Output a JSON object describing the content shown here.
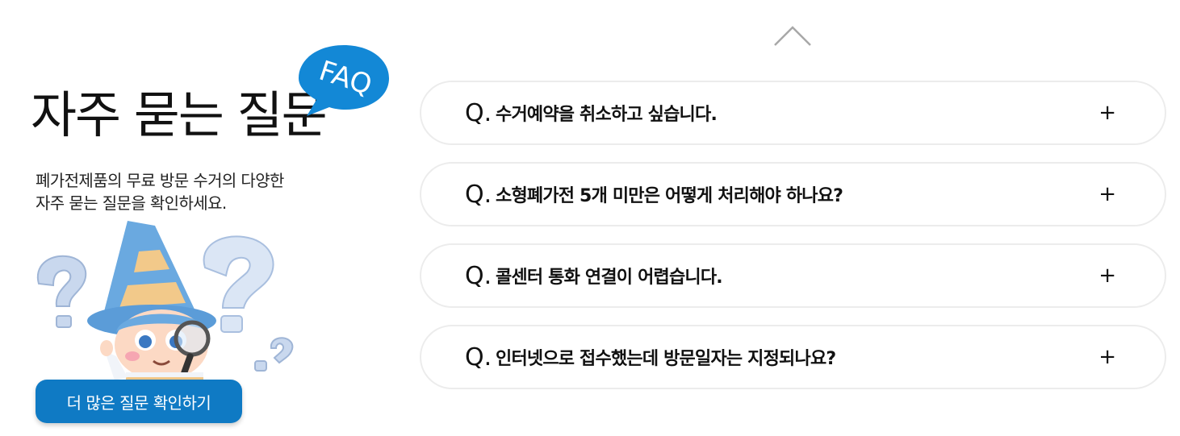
{
  "left": {
    "title": "자주 묻는 질문",
    "bubble_text": "FAQ",
    "description_lines": [
      "폐가전제품의 무료 방문 수거의 다양한",
      "자주 묻는 질문을 확인하세요."
    ],
    "more_button_label": "더 많은 질문 확인하기"
  },
  "colors": {
    "accent": "#0f7ac4",
    "bubble": "#1388d6"
  },
  "faq": {
    "prefix": "Q.",
    "expand_icon": "plus-icon",
    "items": [
      {
        "question": "수거예약을 취소하고 싶습니다."
      },
      {
        "question": "소형폐가전 5개 미만은 어떻게 처리해야 하나요?"
      },
      {
        "question": "콜센터 통화 연결이 어렵습니다."
      },
      {
        "question": "인터넷으로 접수했는데 방문일자는 지정되나요?"
      }
    ]
  }
}
